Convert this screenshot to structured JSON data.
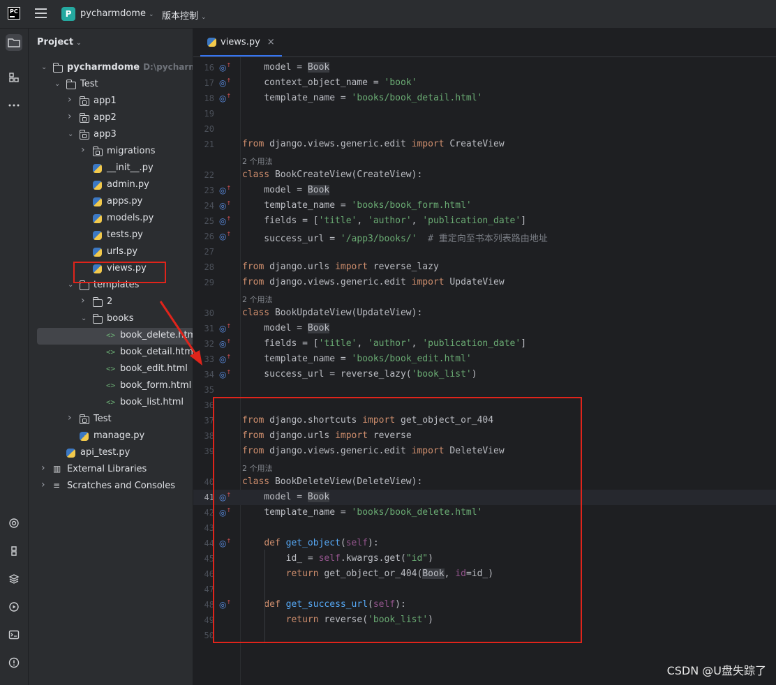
{
  "titlebar": {
    "logo": "PC",
    "project_badge": "P",
    "project_name": "pycharmdome",
    "vcs_menu": "版本控制",
    "chevron": "⌄"
  },
  "project_panel": {
    "title": "Project",
    "title_chevron": "⌄",
    "tree": [
      {
        "label": "pycharmdome",
        "suffix": "D:\\pycharmdome",
        "icon": "folder-icon",
        "depth": 0,
        "expanded": true,
        "bold": true
      },
      {
        "label": "Test",
        "icon": "folder-icon",
        "depth": 1,
        "expanded": true
      },
      {
        "label": "app1",
        "icon": "package-icon",
        "depth": 2,
        "expanded": false
      },
      {
        "label": "app2",
        "icon": "package-icon",
        "depth": 2,
        "expanded": false
      },
      {
        "label": "app3",
        "icon": "package-icon",
        "depth": 2,
        "expanded": true
      },
      {
        "label": "migrations",
        "icon": "package-icon",
        "depth": 3,
        "expanded": false
      },
      {
        "label": "__init__.py",
        "icon": "python-file-icon",
        "depth": 3
      },
      {
        "label": "admin.py",
        "icon": "python-file-icon",
        "depth": 3
      },
      {
        "label": "apps.py",
        "icon": "python-file-icon",
        "depth": 3
      },
      {
        "label": "models.py",
        "icon": "python-file-icon",
        "depth": 3
      },
      {
        "label": "tests.py",
        "icon": "python-file-icon",
        "depth": 3
      },
      {
        "label": "urls.py",
        "icon": "python-file-icon",
        "depth": 3
      },
      {
        "label": "views.py",
        "icon": "python-file-icon",
        "depth": 3,
        "highlighted": true
      },
      {
        "label": "templates",
        "icon": "folder-icon",
        "depth": 2,
        "expanded": true
      },
      {
        "label": "2",
        "icon": "folder-icon",
        "depth": 3,
        "expanded": false
      },
      {
        "label": "books",
        "icon": "folder-icon",
        "depth": 3,
        "expanded": true
      },
      {
        "label": "book_delete.html",
        "icon": "html-file-icon",
        "depth": 4,
        "selected": true
      },
      {
        "label": "book_detail.html",
        "icon": "html-file-icon",
        "depth": 4
      },
      {
        "label": "book_edit.html",
        "icon": "html-file-icon",
        "depth": 4
      },
      {
        "label": "book_form.html",
        "icon": "html-file-icon",
        "depth": 4
      },
      {
        "label": "book_list.html",
        "icon": "html-file-icon",
        "depth": 4
      },
      {
        "label": "Test",
        "icon": "package-icon",
        "depth": 2,
        "expanded": false
      },
      {
        "label": "manage.py",
        "icon": "python-file-icon",
        "depth": 2
      },
      {
        "label": "api_test.py",
        "icon": "python-file-icon",
        "depth": 1
      },
      {
        "label": "External Libraries",
        "icon": "library-icon",
        "depth": 0,
        "expanded": false
      },
      {
        "label": "Scratches and Consoles",
        "icon": "scratches-icon",
        "depth": 0,
        "expanded": false
      }
    ]
  },
  "editor": {
    "tab_label": "views.py",
    "tab_close": "×",
    "lines": [
      {
        "n": "16",
        "marker": true,
        "tokens": [
          [
            "    model = ",
            ""
          ],
          [
            "Book",
            "hl"
          ]
        ]
      },
      {
        "n": "17",
        "marker": true,
        "tokens": [
          [
            "    context_object_name = ",
            ""
          ],
          [
            "'book'",
            "str"
          ]
        ]
      },
      {
        "n": "18",
        "marker": true,
        "tokens": [
          [
            "    template_name = ",
            ""
          ],
          [
            "'books/book_detail.html'",
            "str"
          ]
        ]
      },
      {
        "n": "19",
        "tokens": []
      },
      {
        "n": "20",
        "tokens": []
      },
      {
        "n": "21",
        "tokens": [
          [
            "from",
            "kw"
          ],
          [
            " django.views.generic.edit ",
            ""
          ],
          [
            "import",
            "kw"
          ],
          [
            " CreateView",
            ""
          ]
        ]
      },
      {
        "hint": "2 个用法"
      },
      {
        "n": "22",
        "tokens": [
          [
            "class",
            "kw"
          ],
          [
            " BookCreateView(CreateView):",
            ""
          ]
        ]
      },
      {
        "n": "23",
        "marker": true,
        "tokens": [
          [
            "    model = ",
            ""
          ],
          [
            "Book",
            "hl"
          ]
        ]
      },
      {
        "n": "24",
        "marker": true,
        "tokens": [
          [
            "    template_name = ",
            ""
          ],
          [
            "'books/book_form.html'",
            "str"
          ]
        ]
      },
      {
        "n": "25",
        "marker": true,
        "tokens": [
          [
            "    fields = [",
            ""
          ],
          [
            "'title'",
            "str"
          ],
          [
            ", ",
            ""
          ],
          [
            "'author'",
            "str"
          ],
          [
            ", ",
            ""
          ],
          [
            "'publication_date'",
            "str"
          ],
          [
            "]",
            ""
          ]
        ]
      },
      {
        "n": "26",
        "marker": true,
        "tokens": [
          [
            "    success_url = ",
            ""
          ],
          [
            "'/app3/books/'",
            "str"
          ],
          [
            "  # 重定向至书本列表路由地址",
            "cmt"
          ]
        ]
      },
      {
        "n": "27",
        "tokens": []
      },
      {
        "n": "28",
        "tokens": [
          [
            "from",
            "kw"
          ],
          [
            " django.urls ",
            ""
          ],
          [
            "import",
            "kw"
          ],
          [
            " reverse_lazy",
            ""
          ]
        ]
      },
      {
        "n": "29",
        "tokens": [
          [
            "from",
            "kw"
          ],
          [
            " django.views.generic.edit ",
            ""
          ],
          [
            "import",
            "kw"
          ],
          [
            " UpdateView",
            ""
          ]
        ]
      },
      {
        "hint": "2 个用法"
      },
      {
        "n": "30",
        "tokens": [
          [
            "class",
            "kw"
          ],
          [
            " BookUpdateView(UpdateView):",
            ""
          ]
        ]
      },
      {
        "n": "31",
        "marker": true,
        "tokens": [
          [
            "    model = ",
            ""
          ],
          [
            "Book",
            "hl"
          ]
        ]
      },
      {
        "n": "32",
        "marker": true,
        "tokens": [
          [
            "    fields = [",
            ""
          ],
          [
            "'title'",
            "str"
          ],
          [
            ", ",
            ""
          ],
          [
            "'author'",
            "str"
          ],
          [
            ", ",
            ""
          ],
          [
            "'publication_date'",
            "str"
          ],
          [
            "]",
            ""
          ]
        ]
      },
      {
        "n": "33",
        "marker": true,
        "tokens": [
          [
            "    template_name = ",
            ""
          ],
          [
            "'books/book_edit.html'",
            "str"
          ]
        ]
      },
      {
        "n": "34",
        "marker": true,
        "tokens": [
          [
            "    success_url = reverse_lazy(",
            ""
          ],
          [
            "'book_list'",
            "str"
          ],
          [
            ")",
            ""
          ]
        ]
      },
      {
        "n": "35",
        "tokens": []
      },
      {
        "n": "36",
        "tokens": []
      },
      {
        "n": "37",
        "tokens": [
          [
            "from",
            "kw"
          ],
          [
            " django.shortcuts ",
            ""
          ],
          [
            "import",
            "kw"
          ],
          [
            " get_object_or_404",
            ""
          ]
        ]
      },
      {
        "n": "38",
        "tokens": [
          [
            "from",
            "kw"
          ],
          [
            " django.urls ",
            ""
          ],
          [
            "import",
            "kw"
          ],
          [
            " reverse",
            ""
          ]
        ]
      },
      {
        "n": "39",
        "tokens": [
          [
            "from",
            "kw"
          ],
          [
            " django.views.generic.edit ",
            ""
          ],
          [
            "import",
            "kw"
          ],
          [
            " DeleteView",
            ""
          ]
        ]
      },
      {
        "hint": "2 个用法"
      },
      {
        "n": "40",
        "tokens": [
          [
            "class",
            "kw"
          ],
          [
            " BookDeleteView(DeleteView):",
            ""
          ]
        ]
      },
      {
        "n": "41",
        "marker": true,
        "current": true,
        "tokens": [
          [
            "    model = ",
            ""
          ],
          [
            "Book",
            "hl"
          ]
        ]
      },
      {
        "n": "42",
        "marker": true,
        "tokens": [
          [
            "    template_name = ",
            ""
          ],
          [
            "'books/book_delete.html'",
            "str"
          ]
        ]
      },
      {
        "n": "43",
        "tokens": []
      },
      {
        "n": "44",
        "marker": true,
        "tokens": [
          [
            "    ",
            ""
          ],
          [
            "def",
            "kw"
          ],
          [
            " ",
            ""
          ],
          [
            "get_object",
            "fn"
          ],
          [
            "(",
            ""
          ],
          [
            "self",
            "slf"
          ],
          [
            "):",
            ""
          ]
        ]
      },
      {
        "n": "45",
        "tokens": [
          [
            "        id_ = ",
            ""
          ],
          [
            "self",
            "slf"
          ],
          [
            ".kwargs.get(",
            ""
          ],
          [
            "\"id\"",
            "str"
          ],
          [
            ")",
            ""
          ]
        ]
      },
      {
        "n": "46",
        "tokens": [
          [
            "        ",
            ""
          ],
          [
            "return",
            "kw"
          ],
          [
            " get_object_or_404(",
            ""
          ],
          [
            "Book",
            "hl"
          ],
          [
            ", ",
            ""
          ],
          [
            "id",
            "slf"
          ],
          [
            "=id_)",
            ""
          ]
        ]
      },
      {
        "n": "47",
        "tokens": []
      },
      {
        "n": "48",
        "marker": true,
        "tokens": [
          [
            "    ",
            ""
          ],
          [
            "def",
            "kw"
          ],
          [
            " ",
            ""
          ],
          [
            "get_success_url",
            "fn"
          ],
          [
            "(",
            ""
          ],
          [
            "self",
            "slf"
          ],
          [
            "):",
            ""
          ]
        ]
      },
      {
        "n": "49",
        "tokens": [
          [
            "        ",
            ""
          ],
          [
            "return",
            "kw"
          ],
          [
            " reverse(",
            ""
          ],
          [
            "'book_list'",
            "str"
          ],
          [
            ")",
            ""
          ]
        ]
      },
      {
        "n": "50",
        "tokens": []
      }
    ]
  },
  "watermark": "CSDN @U盘失踪了",
  "colors": {
    "accent": "#3574f0",
    "annotation_red": "#e0241b"
  }
}
